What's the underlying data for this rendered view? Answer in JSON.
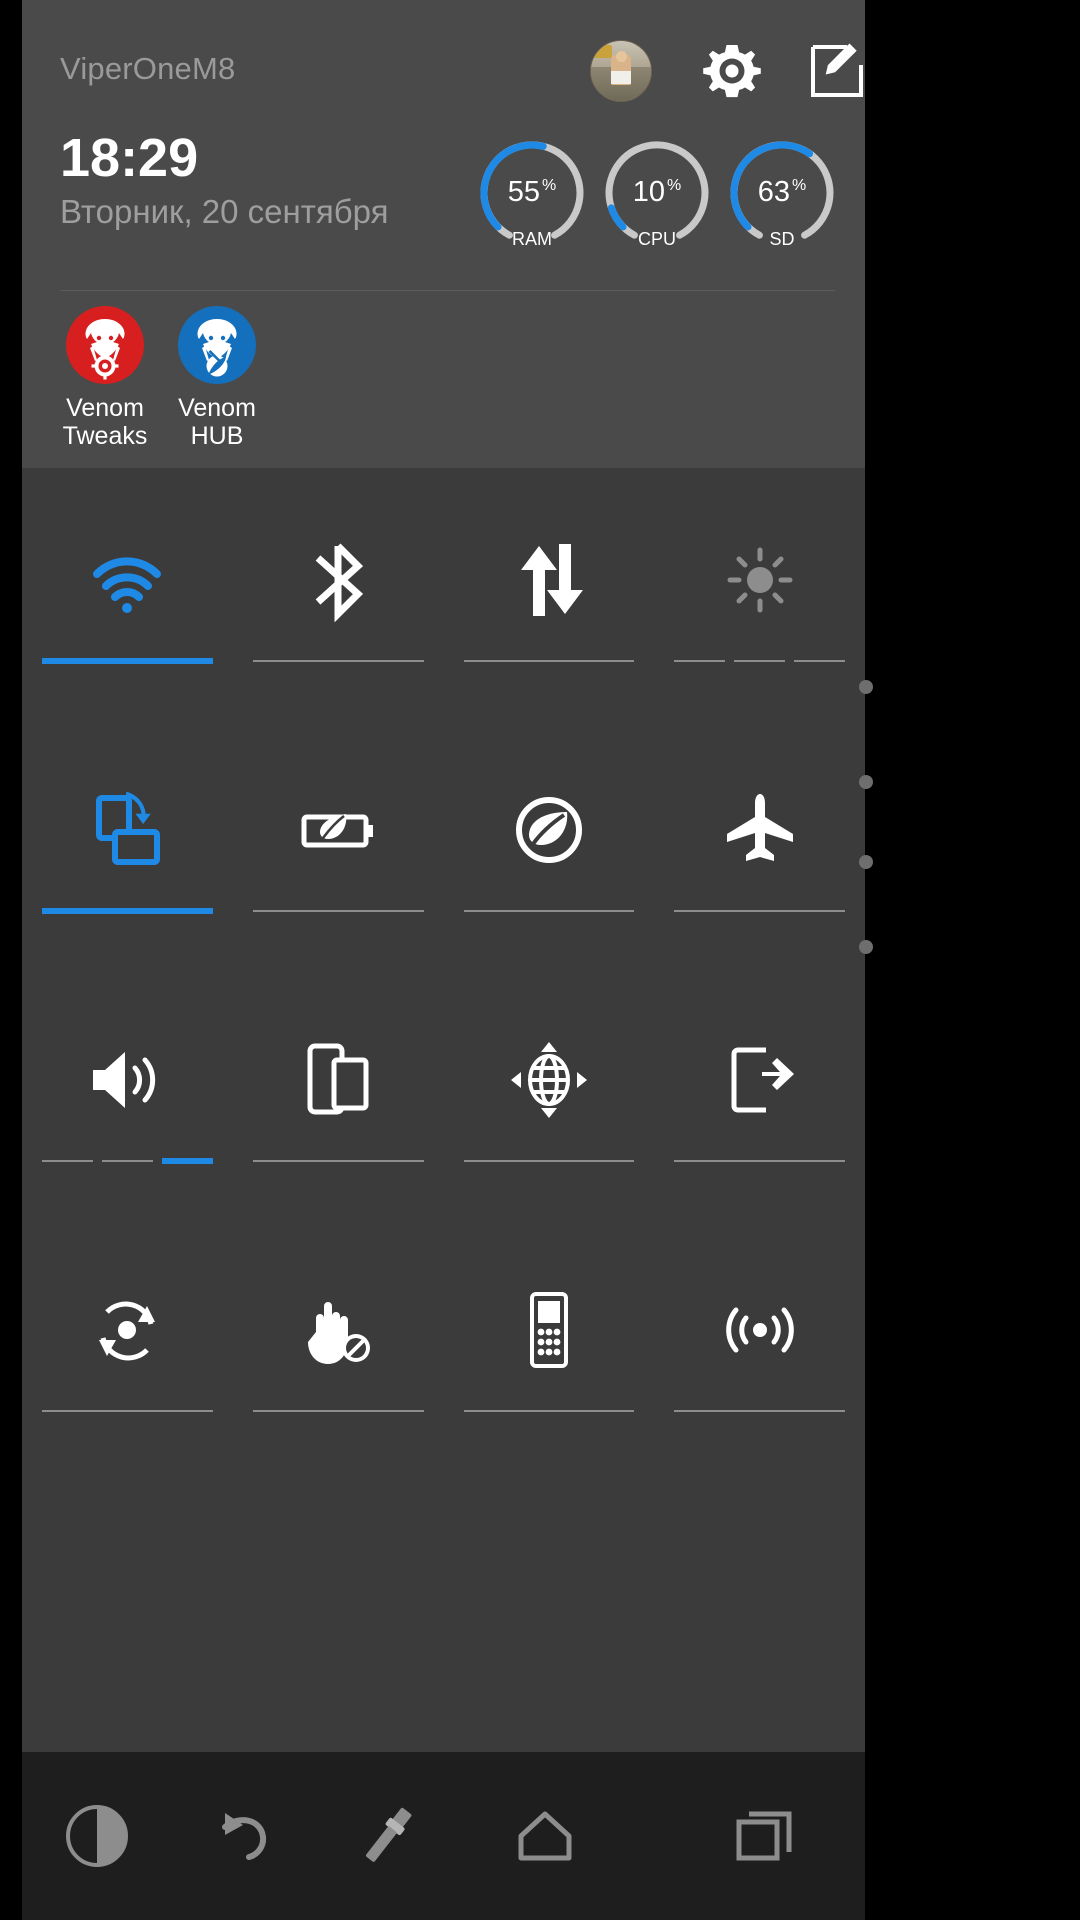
{
  "header": {
    "device_name": "ViperOneM8",
    "avatar": "user-avatar",
    "settings_icon": "gear-icon",
    "edit_icon": "edit-icon",
    "time": "18:29",
    "date": "Вторник, 20 сентября"
  },
  "gauges": [
    {
      "value": "55",
      "unit": "%",
      "label": "RAM",
      "percent": 55,
      "color": "#1e8ae6"
    },
    {
      "value": "10",
      "unit": "%",
      "label": "CPU",
      "percent": 10,
      "color": "#1e8ae6"
    },
    {
      "value": "63",
      "unit": "%",
      "label": "SD",
      "percent": 63,
      "color": "#1e8ae6"
    }
  ],
  "shortcuts": [
    {
      "label_line1": "Venom",
      "label_line2": "Tweaks",
      "icon": "viper-gear-icon",
      "color": "#d81f1f"
    },
    {
      "label_line1": "Venom",
      "label_line2": "HUB",
      "icon": "viper-rocket-icon",
      "color": "#1470bd"
    }
  ],
  "tiles": [
    {
      "name": "wifi",
      "icon": "wifi-icon",
      "state": "on",
      "segments": 1,
      "active_segment": 0
    },
    {
      "name": "bluetooth",
      "icon": "bluetooth-icon",
      "state": "off",
      "segments": 1,
      "active_segment": -1
    },
    {
      "name": "mobile-data",
      "icon": "data-transfer-icon",
      "state": "off",
      "segments": 1,
      "active_segment": -1
    },
    {
      "name": "brightness",
      "icon": "brightness-icon",
      "state": "off",
      "segments": 3,
      "active_segment": -1
    },
    {
      "name": "auto-rotate",
      "icon": "rotate-screen-icon",
      "state": "on",
      "segments": 1,
      "active_segment": 0
    },
    {
      "name": "battery-saver",
      "icon": "battery-leaf-icon",
      "state": "off",
      "segments": 1,
      "active_segment": -1
    },
    {
      "name": "extreme-power",
      "icon": "power-leaf-icon",
      "state": "off",
      "segments": 1,
      "active_segment": -1
    },
    {
      "name": "airplane-mode",
      "icon": "airplane-icon",
      "state": "off",
      "segments": 1,
      "active_segment": -1
    },
    {
      "name": "sound-profile",
      "icon": "volume-icon",
      "state": "off",
      "segments": 3,
      "active_segment": 2
    },
    {
      "name": "cast-screen",
      "icon": "screen-mirror-icon",
      "state": "off",
      "segments": 1,
      "active_segment": -1
    },
    {
      "name": "location",
      "icon": "globe-location-icon",
      "state": "off",
      "segments": 1,
      "active_segment": -1
    },
    {
      "name": "usb-tether",
      "icon": "phone-transfer-icon",
      "state": "off",
      "segments": 1,
      "active_segment": -1
    },
    {
      "name": "sync",
      "icon": "sync-icon",
      "state": "off",
      "segments": 1,
      "active_segment": -1
    },
    {
      "name": "gestures-off",
      "icon": "hand-block-icon",
      "state": "off",
      "segments": 1,
      "active_segment": -1
    },
    {
      "name": "remote",
      "icon": "feature-phone-icon",
      "state": "off",
      "segments": 1,
      "active_segment": -1
    },
    {
      "name": "hotspot",
      "icon": "broadcast-icon",
      "state": "off",
      "segments": 1,
      "active_segment": -1
    }
  ],
  "navbar": [
    {
      "name": "contrast-button",
      "icon": "contrast-icon"
    },
    {
      "name": "back-button",
      "icon": "back-arrow-icon"
    },
    {
      "name": "torch-button",
      "icon": "flashlight-icon"
    },
    {
      "name": "home-button",
      "icon": "home-icon"
    },
    {
      "name": "recents-button",
      "icon": "recents-icon"
    }
  ],
  "colors": {
    "accent": "#1e8ae6",
    "panel_bg": "#3e3e3e",
    "header_bg": "#4a4a4a",
    "tiles_bg": "#3b3b3b",
    "navbar_bg": "#1e1e1e",
    "inactive": "#8d8d8d"
  }
}
